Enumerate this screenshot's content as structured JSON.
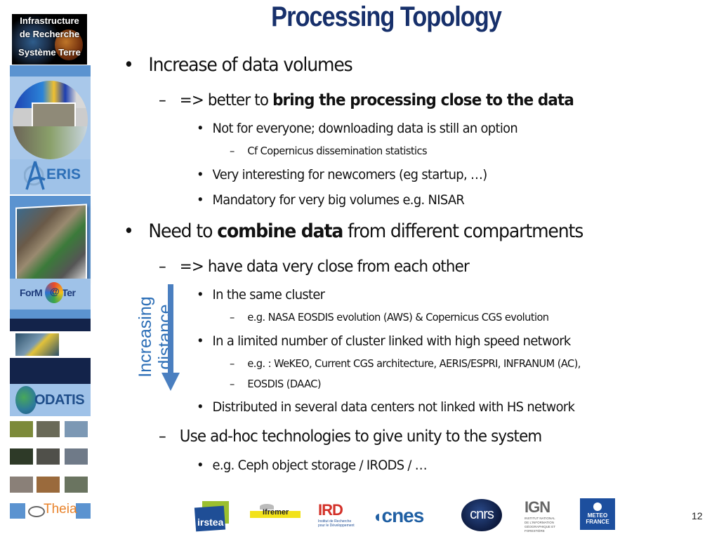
{
  "slide": {
    "title": "Processing Topology",
    "page_number": "12"
  },
  "sidebar": {
    "header_logo": {
      "line1": "Infrastructure",
      "line2": "de Recherche",
      "line3": "Système Terre"
    },
    "logos": {
      "aeris": "ERIS",
      "formater": "ForM",
      "formater_at": "@",
      "formater_tail": "Ter",
      "odatis": "ODATIS",
      "theia": "Theia"
    }
  },
  "content": {
    "b1": {
      "text": "Increase of data volumes"
    },
    "b1_1": {
      "prefix": "=> better to ",
      "bold": "bring the processing close to the data"
    },
    "b1_1_1": {
      "text": "Not for everyone; downloading data is still an option"
    },
    "b1_1_1_1": {
      "text": "Cf Copernicus dissemination statistics"
    },
    "b1_1_2": {
      "text": "Very interesting for newcomers (eg startup, …)"
    },
    "b1_1_3": {
      "text": "Mandatory for very big volumes e.g. NISAR"
    },
    "b2": {
      "prefix": "Need to ",
      "bold": "combine data",
      "suffix": " from different compartments"
    },
    "b2_1": {
      "text": "=> have data very close from each other"
    },
    "b2_1_1": {
      "text": "In the same cluster"
    },
    "b2_1_1_1": {
      "text": "e.g. NASA EOSDIS evolution (AWS) & Copernicus CGS evolution"
    },
    "b2_1_2": {
      "text": "In a limited number of cluster linked with high speed network"
    },
    "b2_1_2_1": {
      "text": "e.g. : WeKEO, Current CGS architecture, AERIS/ESPRI, INFRANUM (AC),"
    },
    "b2_1_2_2": {
      "text": "EOSDIS (DAAC)"
    },
    "b2_1_3": {
      "text": "Distributed in several data centers not linked with HS network"
    },
    "b2_2": {
      "text": "Use ad-hoc technologies to give unity to the system"
    },
    "b2_2_1": {
      "text": "e.g. Ceph object storage / IRODS / …"
    }
  },
  "bullets": {
    "dot": "•",
    "dash": "–"
  },
  "arrow_annotation": {
    "line1": "Increasing",
    "line2": "distance",
    "color": "#4a7fc0"
  },
  "footer_logos": {
    "irstea": "irstea",
    "ifremer": "Ifremer",
    "ird": "IRD",
    "ird_sub": "Institut de Recherche pour le Développement",
    "cnes": "cnes",
    "cnrs": "cnrs",
    "ign": "IGN",
    "ign_sub": "INSTITUT NATIONAL DE L'INFORMATION GÉOGRAPHIQUE ET FORESTIÈRE",
    "meteo": "METEO FRANCE"
  },
  "colors": {
    "title": "#17306b",
    "sidebar_blue": "#5b93d0",
    "sidebar_light": "#a9c8ea"
  }
}
